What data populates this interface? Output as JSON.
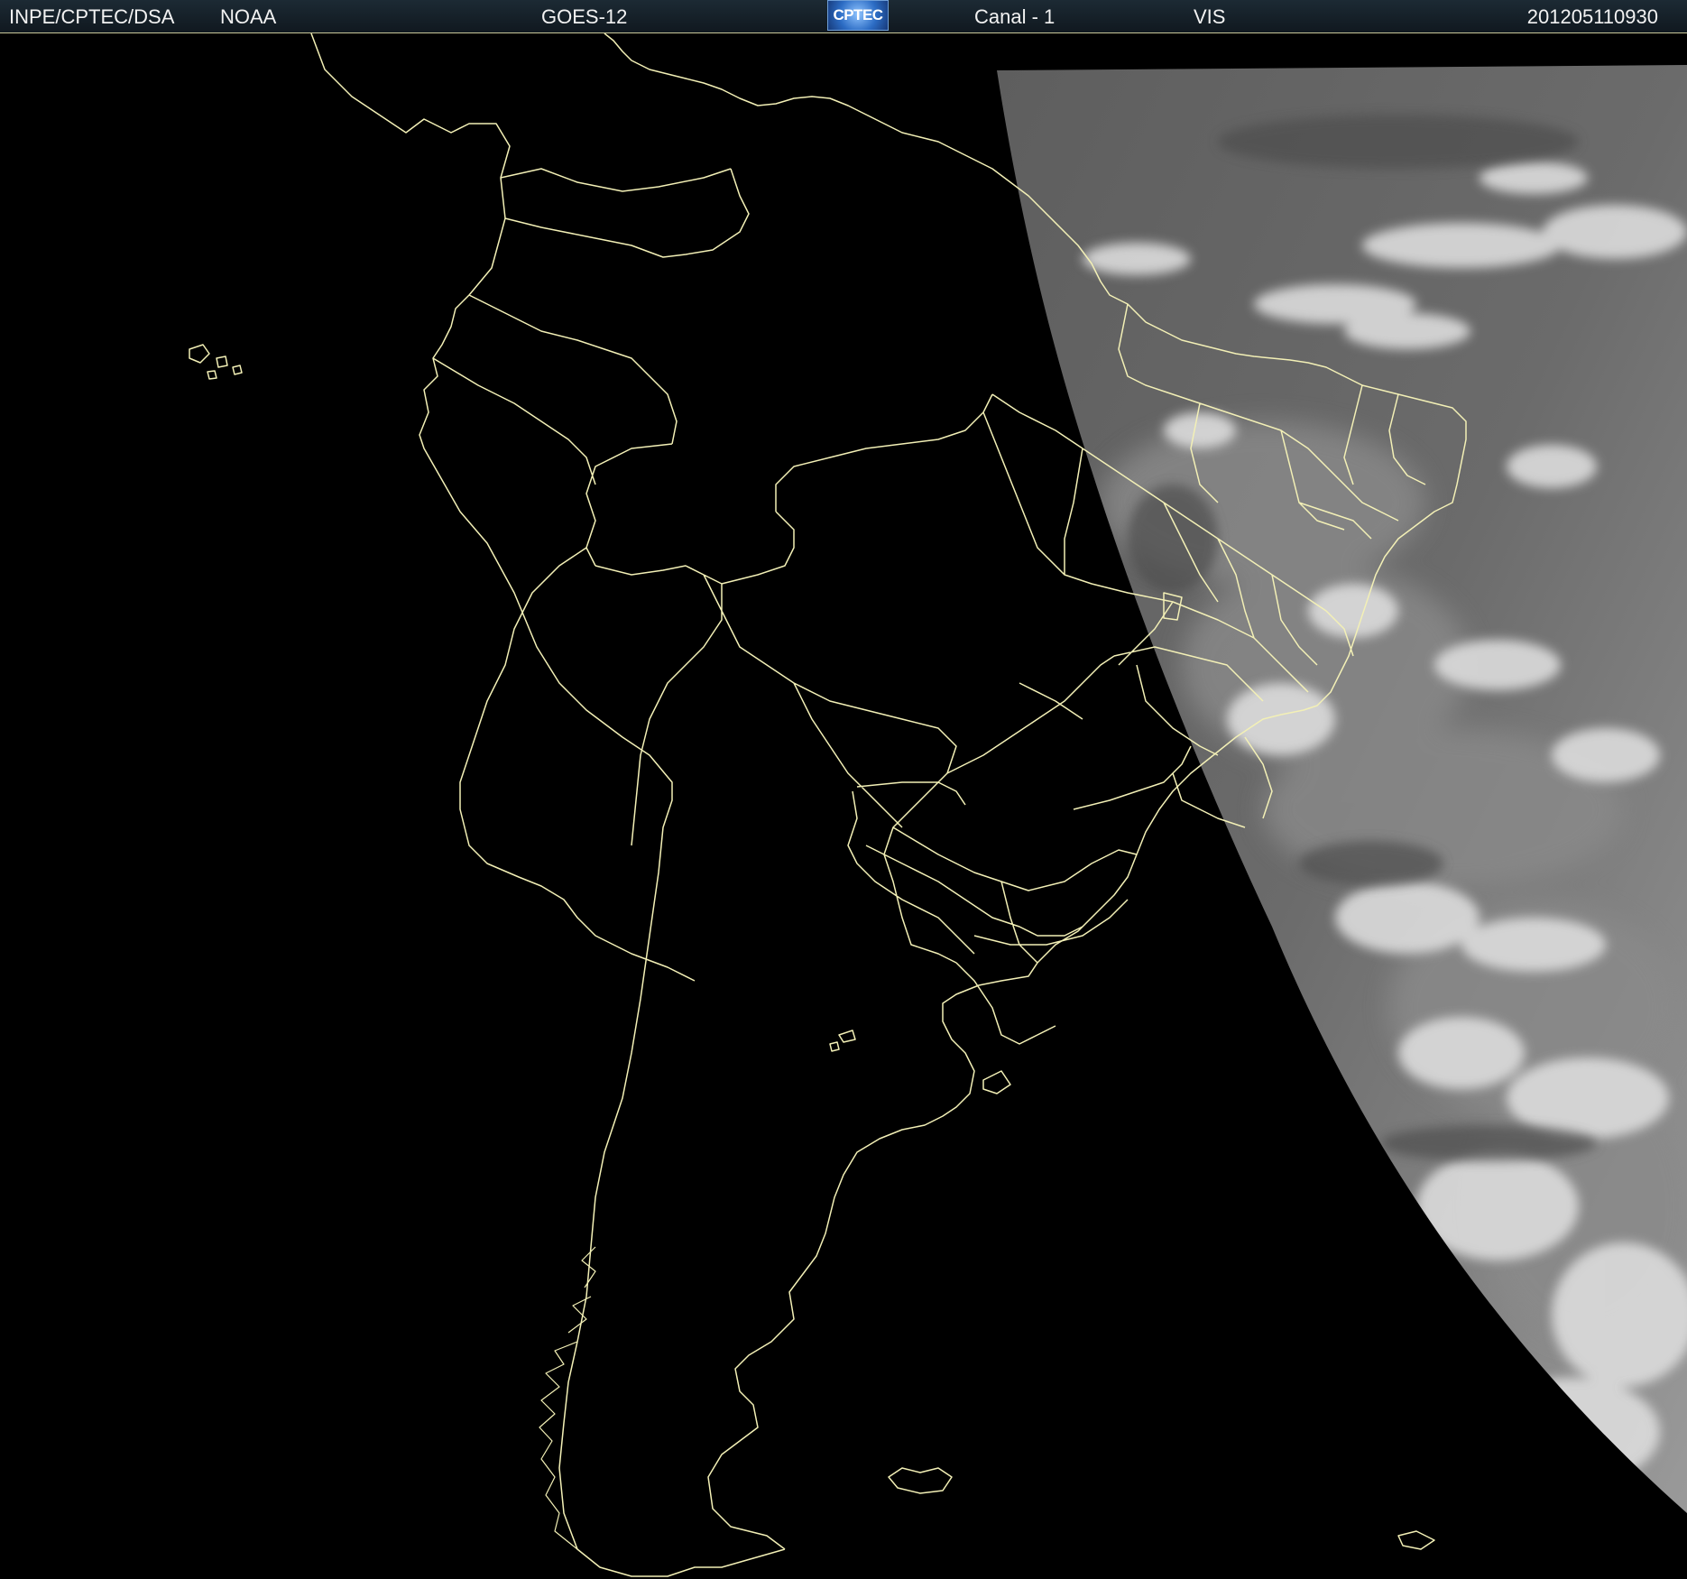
{
  "header": {
    "source": "INPE/CPTEC/DSA",
    "agency": "NOAA",
    "satellite": "GOES-12",
    "logo_text": "CPTEC",
    "channel": "Canal - 1",
    "band": "VIS",
    "timestamp": "201205110930"
  },
  "colors": {
    "background": "#000000",
    "coastline": "#f3f0b6",
    "header_bg": "#14202a",
    "header_text": "#f2f2f2",
    "cloud_gray": "#6a6a6a",
    "cloud_white": "#e8e8e8"
  },
  "map": {
    "region": "South America",
    "overlay": "coastlines and political borders",
    "imagery": "visible channel, terminator with daylit clouds on the east"
  }
}
